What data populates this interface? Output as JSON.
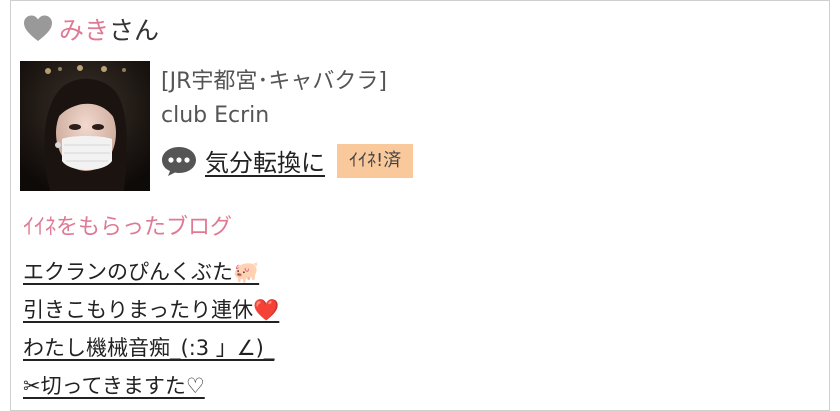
{
  "header": {
    "name": "みき",
    "honorific": "さん",
    "heart_icon": "heart-icon",
    "heart_color": "#999999"
  },
  "profile": {
    "category": "[JR宇都宮･キャバクラ]",
    "club": "club Ecrin",
    "action_label": "気分転換に",
    "action_icon": "speech-bubble-icon",
    "badge_label": "ｲｲﾈ!済"
  },
  "blog": {
    "title": "ｲｲﾈをもらったブログ",
    "items": [
      {
        "label": "エクランのぴんくぶた🐖"
      },
      {
        "label": "引きこもりまったり連休❤️"
      },
      {
        "label": "わたし機械音痴_(:3 」∠)_"
      },
      {
        "label": "✂︎切ってきますた♡"
      }
    ]
  },
  "colors": {
    "accent_pink": "#e07a94",
    "badge_bg": "#f9c89b",
    "border": "#cfcfcf"
  }
}
